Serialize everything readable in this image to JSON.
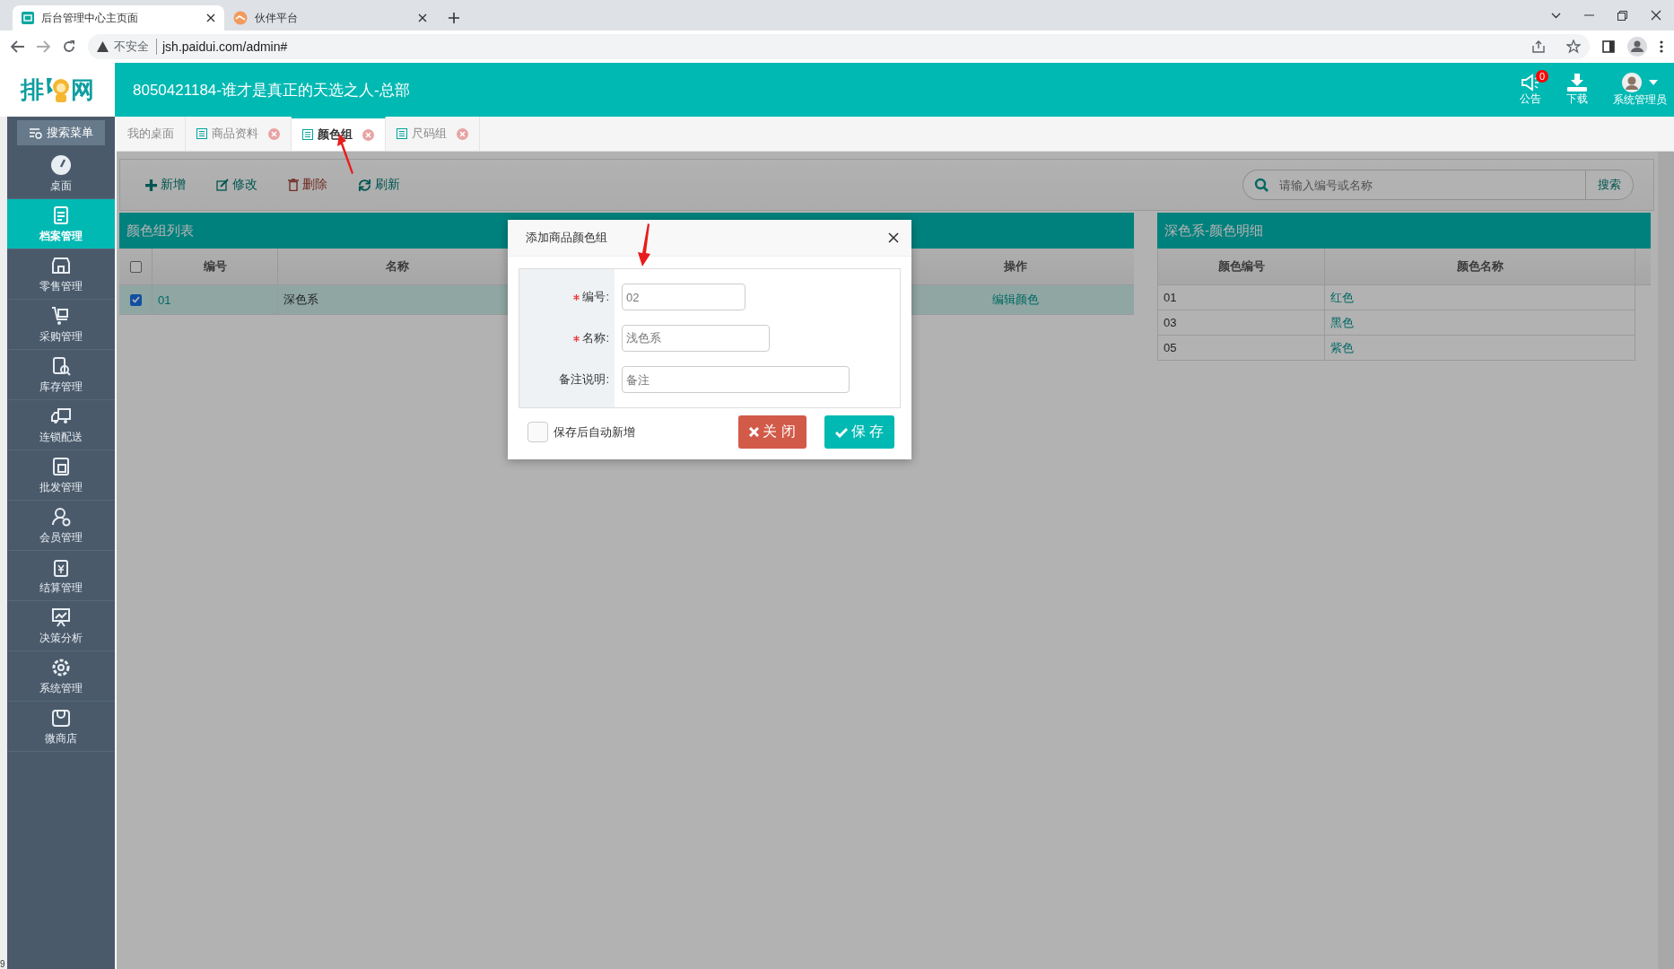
{
  "browser": {
    "tabs": [
      {
        "title": "后台管理中心主页面",
        "selected": true
      },
      {
        "title": "伙伴平台",
        "selected": false
      }
    ],
    "address": {
      "security": "不安全",
      "url": "jsh.paidui.com/admin#"
    }
  },
  "header": {
    "logo_left": "排",
    "logo_right": "网",
    "title": "8050421184-谁才是真正的天选之人-总部",
    "notice": {
      "label": "公告",
      "badge": "0"
    },
    "download": "下载",
    "user": "系统管理员"
  },
  "sidebar": {
    "search": "搜索菜单",
    "items": [
      {
        "label": "桌面",
        "selected": false
      },
      {
        "label": "档案管理",
        "selected": true
      },
      {
        "label": "零售管理",
        "selected": false
      },
      {
        "label": "采购管理",
        "selected": false
      },
      {
        "label": "库存管理",
        "selected": false
      },
      {
        "label": "连锁配送",
        "selected": false
      },
      {
        "label": "批发管理",
        "selected": false
      },
      {
        "label": "会员管理",
        "selected": false
      },
      {
        "label": "结算管理",
        "selected": false
      },
      {
        "label": "决策分析",
        "selected": false
      },
      {
        "label": "系统管理",
        "selected": false
      },
      {
        "label": "微商店",
        "selected": false
      }
    ]
  },
  "page_tabs": [
    {
      "label": "我的桌面",
      "selected": false,
      "closable": false
    },
    {
      "label": "商品资料",
      "selected": false,
      "closable": true
    },
    {
      "label": "颜色组",
      "selected": true,
      "closable": true
    },
    {
      "label": "尺码组",
      "selected": false,
      "closable": true
    }
  ],
  "toolbar": [
    {
      "label": "新增",
      "kind": "add"
    },
    {
      "label": "修改",
      "kind": "edit"
    },
    {
      "label": "删除",
      "kind": "delete"
    },
    {
      "label": "刷新",
      "kind": "refresh"
    }
  ],
  "search": {
    "placeholder": "请输入编号或名称",
    "button": "搜索"
  },
  "group_list": {
    "title": "颜色组列表",
    "all_checked": false,
    "columns": [
      "编号",
      "名称",
      "操作"
    ],
    "rows": [
      {
        "checked": true,
        "selected": true,
        "code": "01",
        "name": "深色系",
        "action": "编辑颜色"
      }
    ]
  },
  "detail": {
    "title": "深色系-颜色明细",
    "columns": [
      "颜色编号",
      "颜色名称"
    ],
    "rows": [
      {
        "code": "01",
        "name": "红色"
      },
      {
        "code": "03",
        "name": "黑色"
      },
      {
        "code": "05",
        "name": "紫色"
      }
    ]
  },
  "dialog": {
    "title": "添加商品颜色组",
    "fields": [
      {
        "label": "编号:",
        "required": true,
        "value": "02"
      },
      {
        "label": "名称:",
        "required": true,
        "value": "浅色系"
      },
      {
        "label": "备注说明:",
        "required": false,
        "placeholder": "备注"
      }
    ],
    "auto_add": {
      "label": "保存后自动新增",
      "checked": false
    },
    "buttons": [
      {
        "label": "关 闭",
        "kind": "close"
      },
      {
        "label": "保 存",
        "kind": "save"
      }
    ]
  },
  "edge_text": "9"
}
